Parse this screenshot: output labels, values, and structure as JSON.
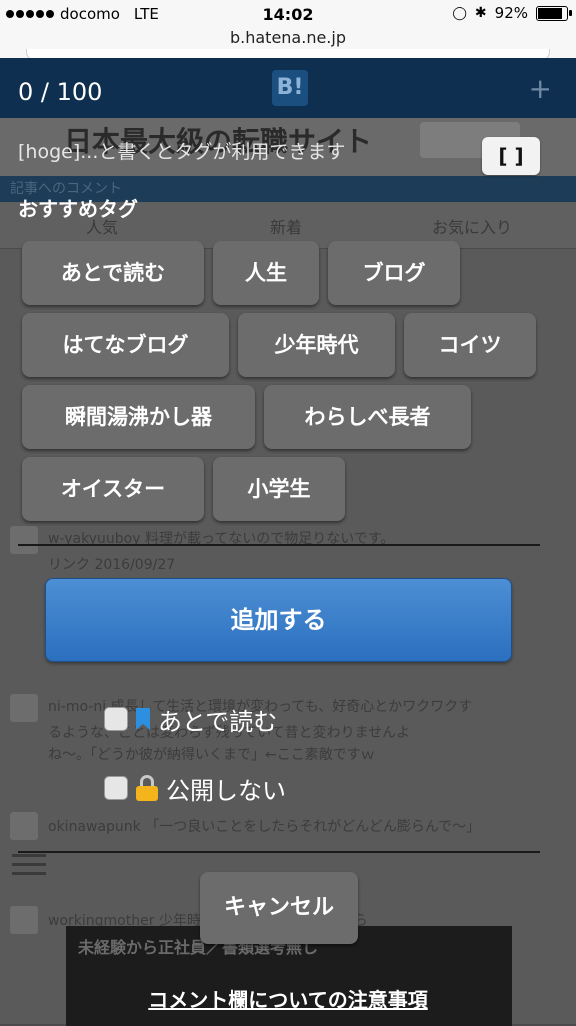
{
  "status_bar": {
    "carrier": "docomo",
    "network": "LTE",
    "time": "14:02",
    "battery": "92%",
    "battery_level": 0.92
  },
  "browser": {
    "url": "b.hatena.ne.jp"
  },
  "background_page": {
    "logo": "B!",
    "ad_headline": "日本最大級の転職サイト",
    "section_label": "記事へのコメント",
    "tabs": [
      "人気",
      "新着",
      "お気に入り"
    ],
    "comments": [
      "w-yakyuuboy 料理が載ってないので物足りないです。",
      "リンク 2016/09/27",
      "ni-mo-ni 成長して生活と環境が変わっても、好奇心とかワクワクす",
      "るような、ことは変わらず残っていて昔と変わりませんよ",
      "ね～。「どうか彼が納得いくまで」←ここ素敵ですｗ",
      "okinawapunk 「一つ良いことをしたらそれがどんどん膨らんで～」",
      "workingmother 少年時代、ブログ楽しませてもら"
    ],
    "ad2_text": "未経験から正社員／書類選考無し"
  },
  "dialog": {
    "counter": "0 / 100",
    "hint": "[hoge]...と書くとタグが利用できます",
    "bracket_button": "[ ]",
    "recommended_title": "おすすめタグ",
    "tags": [
      "あとで読む",
      "人生",
      "ブログ",
      "はてなブログ",
      "少年時代",
      "コイツ",
      "瞬間湯沸かし器",
      "わらしべ長者",
      "オイスター",
      "小学生"
    ],
    "add_button": "追加する",
    "options": [
      {
        "label": "あとで読む",
        "icon": "bookmark-icon",
        "checked": false
      },
      {
        "label": "公開しない",
        "icon": "lock-icon",
        "checked": false
      }
    ],
    "cancel_button": "キャンセル",
    "notice_link": "コメント欄についての注意事項"
  }
}
